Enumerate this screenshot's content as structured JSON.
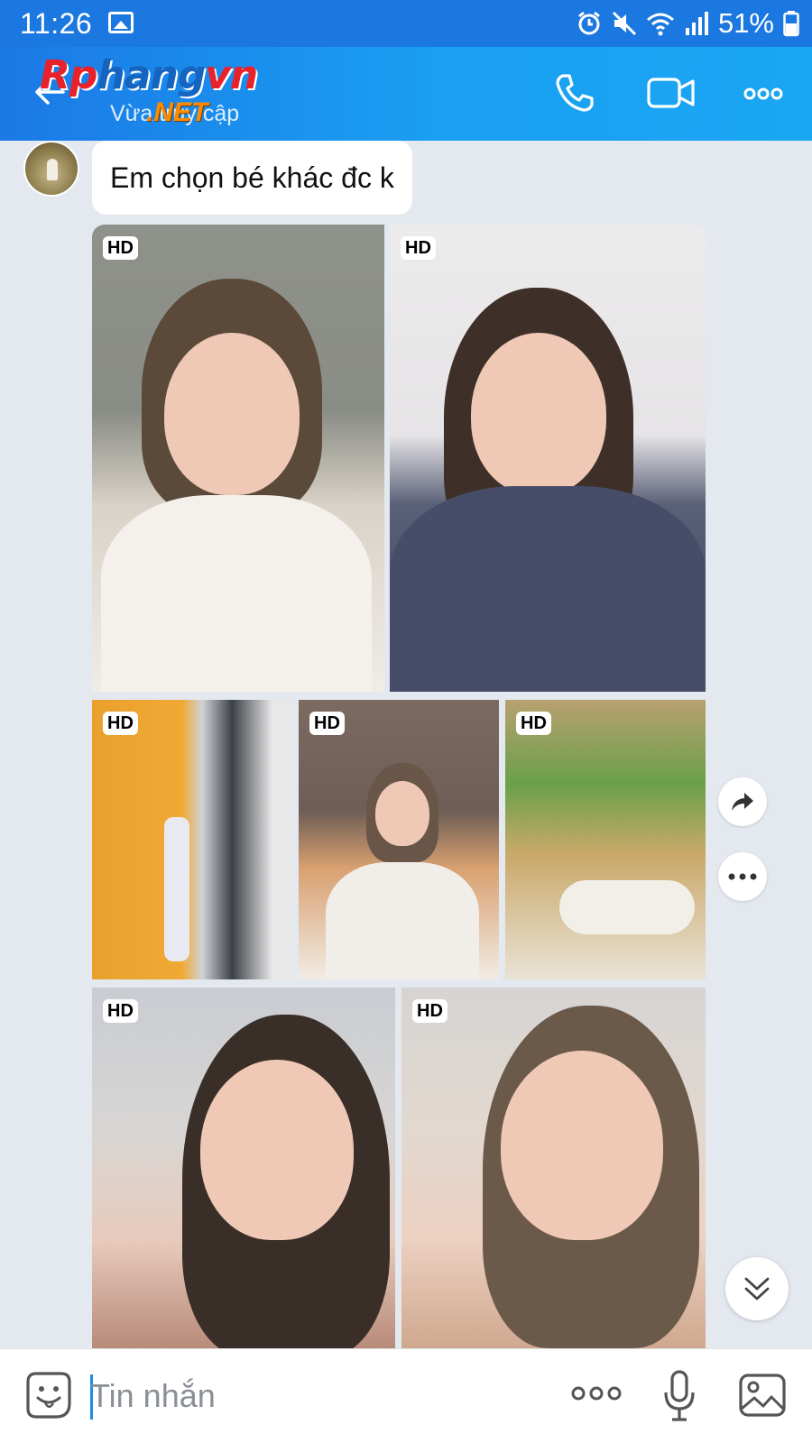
{
  "status_bar": {
    "time": "11:26",
    "battery": "51%"
  },
  "header": {
    "brand_part1": "Rp",
    "brand_part2": "hang",
    "brand_part3": "vn",
    "brand_net": ".NET",
    "contact_status": "Vừa truy cập"
  },
  "messages": [
    {
      "text": "Em chọn bé khác đc k"
    }
  ],
  "photos": {
    "badge": "HD",
    "count": 7
  },
  "composer": {
    "placeholder": "Tin nhắn"
  },
  "colors": {
    "header_start": "#1b79e6",
    "header_end": "#1aa6f3",
    "chat_background": "#e4e8ef",
    "accent": "#1b8de6"
  },
  "icons": [
    "gallery-icon",
    "alarm-icon",
    "mute-icon",
    "wifi-icon",
    "signal-icon",
    "battery-icon",
    "back-arrow-icon",
    "phone-icon",
    "video-camera-icon",
    "more-dots-icon",
    "share-arrow-icon",
    "chevron-double-down-icon",
    "sticker-icon",
    "microphone-icon",
    "image-icon"
  ]
}
